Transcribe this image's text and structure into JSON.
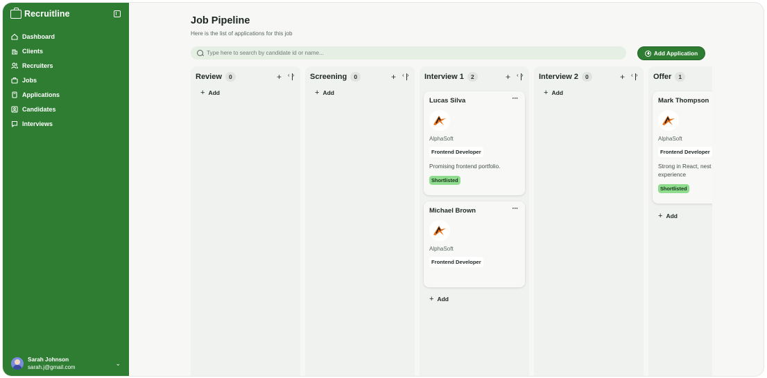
{
  "sidebar": {
    "brand": "Recruitline",
    "items": [
      {
        "label": "Dashboard",
        "icon": "home-icon"
      },
      {
        "label": "Clients",
        "icon": "building-icon"
      },
      {
        "label": "Recruiters",
        "icon": "users-icon"
      },
      {
        "label": "Jobs",
        "icon": "briefcase-icon"
      },
      {
        "label": "Applications",
        "icon": "document-icon"
      },
      {
        "label": "Candidates",
        "icon": "id-card-icon"
      },
      {
        "label": "Interviews",
        "icon": "chat-icon"
      }
    ],
    "user": {
      "name": "Sarah Johnson",
      "email": "sarah.j@gmail.com"
    }
  },
  "header": {
    "title": "Job Pipeline",
    "subtitle": "Here is the list of applications for this job"
  },
  "search": {
    "placeholder": "Type here to search by candidate id or name..."
  },
  "actions": {
    "add_application": "Add Application"
  },
  "add_label": "Add",
  "columns": [
    {
      "title": "Review",
      "count": "0",
      "cards": []
    },
    {
      "title": "Screening",
      "count": "0",
      "cards": []
    },
    {
      "title": "Interview 1",
      "count": "2",
      "cards": [
        {
          "name": "Lucas Silva",
          "company": "AlphaSoft",
          "role": "Frontend Developer",
          "note": "Promising frontend portfolio.",
          "tag": "Shortlisted"
        },
        {
          "name": "Michael Brown",
          "company": "AlphaSoft",
          "role": "Frontend Developer",
          "note": "",
          "tag": ""
        }
      ]
    },
    {
      "title": "Interview 2",
      "count": "0",
      "cards": []
    },
    {
      "title": "Offer",
      "count": "1",
      "cards": [
        {
          "name": "Mark Thompson",
          "company": "AlphaSoft",
          "role": "Frontend Developer",
          "note": "Strong in React, nest experience",
          "tag": "Shortlisted"
        }
      ]
    }
  ],
  "colors": {
    "brand": "#2e7d32",
    "tag": "#8fdc8f",
    "logo_accent": "#e8731a"
  }
}
